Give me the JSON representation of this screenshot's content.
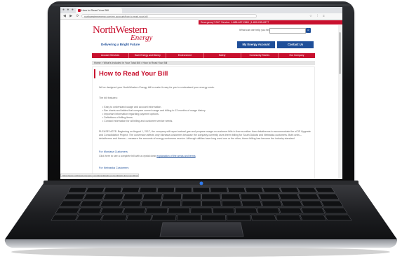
{
  "browser": {
    "tab_title": "How to Read Your Bill",
    "url": "northwesternenergy.com/my-account/how-to-read-your-bill",
    "window_dots": "● ● ●",
    "nav_arrows": "◀ ▶ ⟳",
    "toolbar_icons": "☆ ⋮ ≡"
  },
  "header": {
    "emergency_text": "Emergency? 24/7 Service: 1-888-467-2669 | 1-800-245-6977",
    "logo_line1": "NorthWestern",
    "logo_line2": "Energy",
    "tagline": "Delivering a Bright Future",
    "search_label": "What can we help you find?",
    "search_icon": "search-icon",
    "search_button": "⌕",
    "my_energy_account": "My Energy Account",
    "contact_us": "Contact Us"
  },
  "nav": {
    "items": [
      "Account Services",
      "Save Energy and Money",
      "Environment",
      "Safety",
      "Community Stories",
      "Our Company"
    ]
  },
  "breadcrumb": "Home > What's Included in Your Total Bill > How to Read Your Bill",
  "main": {
    "title": "How to Read Your Bill",
    "intro": "We've designed your NorthWestern Energy bill to make it easy for you to understand your energy costs.",
    "features_label": "The bill features:",
    "features": [
      "Easy to understand usage and account information.",
      "Bar charts and tables that compare current usage and billing to 13 months of usage history.",
      "Important information regarding payment options.",
      "Definitions of billing items.",
      "Contact information for all billing and customer service needs."
    ],
    "notice": "PLEASE NOTE: Beginning on August 1, 2017, the company will report natural gas and propane usage on customer bills in therms rather than dekatherms to accommodate the eCIS Upgrade and Consolidation Project. The conversion affects only Montana customers because the company currently uses therm billing for South Dakota and Nebraska customers. Both units – dekatherms and therms – measure the amounts of energy customers receive. Although utilities have long used one or the other, therm billing has become the industry standard.",
    "montana_heading": "For Montana Customers",
    "montana_text": "Click here to see a complete bill with a crystal clear",
    "montana_link": "explanation of the areas and terms",
    "nebraska_heading": "For Nebraska Customers"
  },
  "status_bar": "https://www.northwesternenergy.com/docs/default-source/default-document-library/my-account/bill-explanation"
}
